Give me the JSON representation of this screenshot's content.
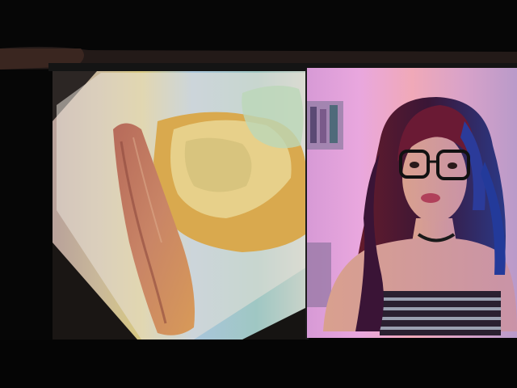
{
  "scene": {
    "left_panel": "food-plate",
    "right_panel": "person-portrait"
  }
}
